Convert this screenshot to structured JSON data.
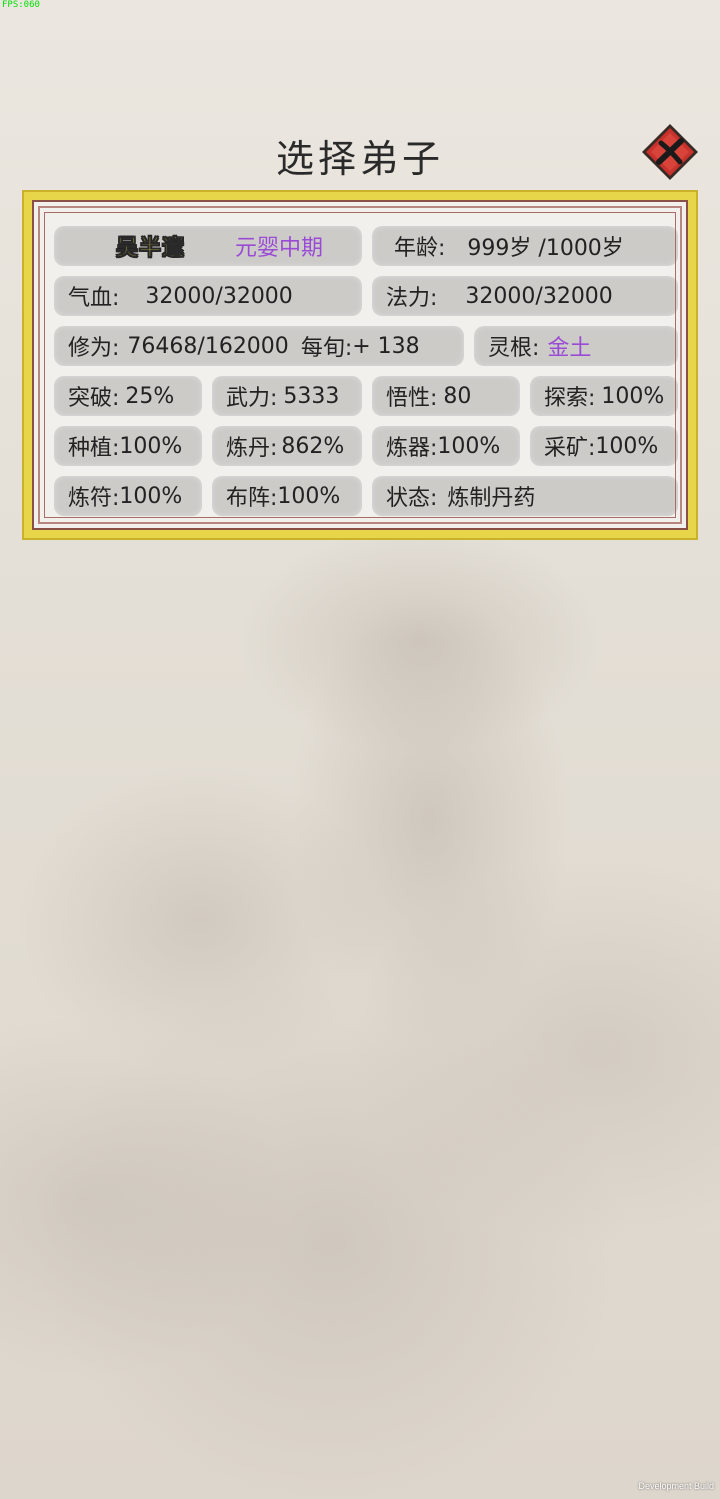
{
  "debug": {
    "fps": "FPS:060",
    "build_label": "Development Build"
  },
  "header": {
    "title": "选择弟子",
    "close_icon": "close-x-icon"
  },
  "disciple": {
    "name": "吴半邃",
    "realm": "元婴中期",
    "age_label": "年龄:",
    "age_value": "999岁 /1000岁",
    "hp_label": "气血:",
    "hp_value": "32000/32000",
    "mp_label": "法力:",
    "mp_value": "32000/32000",
    "cultivation_label": "修为:",
    "cultivation_value": "76468/162000",
    "per_turn_label": "每旬:",
    "per_turn_value": "+ 138",
    "root_label": "灵根:",
    "root_value": "金土",
    "stats": {
      "breakthrough_label": "突破:",
      "breakthrough_value": "25%",
      "force_label": "武力:",
      "force_value": "5333",
      "insight_label": "悟性:",
      "insight_value": "80",
      "explore_label": "探索:",
      "explore_value": "100%",
      "plant_label": "种植:",
      "plant_value": "100%",
      "alchemy_label": "炼丹:",
      "alchemy_value": "862%",
      "forge_label": "炼器:",
      "forge_value": "100%",
      "mining_label": "采矿:",
      "mining_value": "100%",
      "talisman_label": "炼符:",
      "talisman_value": "100%",
      "formation_label": "布阵:",
      "formation_value": "100%",
      "status_label": "状态:",
      "status_value": "炼制丹药"
    }
  },
  "colors": {
    "frame_gold": "#e8d64a",
    "frame_red": "#8a4f46",
    "realm_purple": "#9a4bd6",
    "name_yellow": "#fff34a",
    "close_button_red": "#c8322c"
  }
}
